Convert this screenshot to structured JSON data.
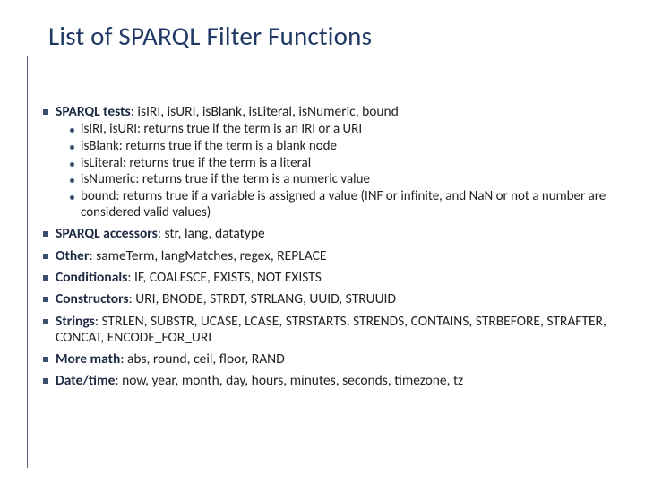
{
  "title": "List of SPARQL Filter Functions",
  "items": [
    {
      "label": "SPARQL tests",
      "text": ": isIRI, isURI, isBlank, isLiteral, isNumeric, bound",
      "sub": [
        "isIRI, isURI: returns true if the term is an IRI or a URI",
        "isBlank: returns true if the term is a blank node",
        "isLiteral: returns true if the term is a literal",
        "isNumeric: returns true if the term is a numeric value",
        "bound: returns true if a variable is assigned a value (INF or infinite, and NaN or not a number are considered valid values)"
      ]
    },
    {
      "label": "SPARQL accessors",
      "text": ": str, lang, datatype"
    },
    {
      "label": "Other",
      "text": ": sameTerm, langMatches, regex, REPLACE"
    },
    {
      "label": "Conditionals",
      "text": ": IF, COALESCE, EXISTS, NOT EXISTS"
    },
    {
      "label": "Constructors",
      "text": ": URI, BNODE, STRDT, STRLANG, UUID, STRUUID"
    },
    {
      "label": "Strings",
      "text": ": STRLEN, SUBSTR, UCASE, LCASE, STRSTARTS, STRENDS, CONTAINS, STRBEFORE, STRAFTER, CONCAT, ENCODE_FOR_URI"
    },
    {
      "label": "More math",
      "text": ": abs, round, ceil, floor, RAND"
    },
    {
      "label": "Date/time",
      "text": ": now, year, month, day, hours, minutes, seconds, timezone, tz"
    }
  ]
}
